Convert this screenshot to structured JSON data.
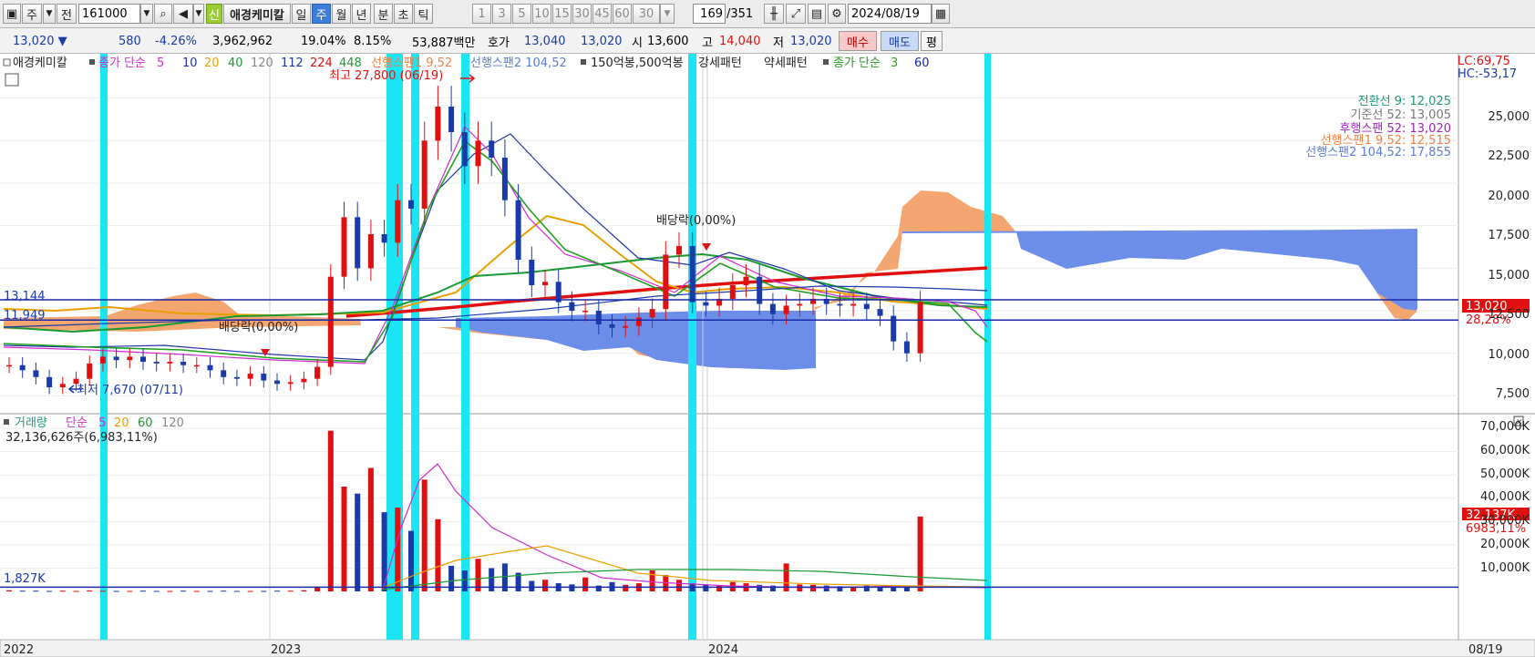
{
  "toolbar": {
    "period_labels": [
      "주",
      "전"
    ],
    "code": "161000",
    "new_badge": "신",
    "stock_name": "애경케미칼",
    "timeframes": [
      "일",
      "주",
      "월",
      "년",
      "분",
      "초",
      "틱"
    ],
    "selected_timeframe": "주",
    "intervals": [
      "1",
      "3",
      "5",
      "10",
      "15",
      "30",
      "45",
      "60"
    ],
    "interval_select": "30",
    "count": "169",
    "count_total": "/351",
    "date": "2024/08/19"
  },
  "quote": {
    "price": "13,020",
    "change": "580",
    "change_rate": "-4.26%",
    "volume": "3,962,962",
    "turnover_rate": "19.04%",
    "ratio2": "8.15%",
    "amount": "53,887백만",
    "bid_label": "호가",
    "bid1": "13,040",
    "bid2": "13,020",
    "open_label": "시",
    "open": "13,600",
    "high_label": "고",
    "high": "14,040",
    "low_label": "저",
    "low": "13,020",
    "buy_label": "매수",
    "sell_label": "매도",
    "avg_label": "평"
  },
  "legend": {
    "name": "애경케미칼",
    "ma_title": "종가 단순",
    "ma": [
      {
        "label": "5",
        "color": "#d02bd0"
      },
      {
        "label": "10",
        "color": "#2233aa"
      },
      {
        "label": "20",
        "color": "#e8a000"
      },
      {
        "label": "40",
        "color": "#1a9a33"
      },
      {
        "label": "120",
        "color": "#888888"
      },
      {
        "label": "112",
        "color": "#1a3aa8"
      },
      {
        "label": "224",
        "color": "#e01010"
      },
      {
        "label": "448",
        "color": "#1a9a33"
      }
    ],
    "span1": "선행스팬1 9,52",
    "span2": "선행스팬2 104,52",
    "pattern_a": "150억봉,500억봉",
    "pattern_b": "강세패턴",
    "pattern_c": "약세패턴",
    "ma2_title": "종가 단순",
    "ma2": [
      {
        "label": "3",
        "color": "#20a020"
      },
      {
        "label": "60",
        "color": "#1a2aa8"
      }
    ]
  },
  "price_panel": {
    "high_marker": "최고 27,800 (06/19)",
    "low_marker": "최저 7,670 (07/11)",
    "dividend1": "배당락(0,00%)",
    "dividend2": "배당락(0,00%)",
    "hline1_label": "13,144",
    "hline2_label": "11,949",
    "lc": "LC:69,75",
    "hc": "HC:-53,17",
    "current_price_label": "13,020",
    "current_rate_label": "28,28%",
    "ichimoku": [
      {
        "text": "전환선 9: 12,025",
        "color": "#1a9a7a"
      },
      {
        "text": "기준선 52: 13,005",
        "color": "#777777"
      },
      {
        "text": "후행스팬 52: 13,020",
        "color": "#a020c0"
      },
      {
        "text": "선행스팬1 9,52: 12,515",
        "color": "#f08040"
      },
      {
        "text": "선행스팬2 104,52: 17,855",
        "color": "#5a7ad8"
      }
    ],
    "y_ticks": [
      "25,000",
      "22,500",
      "20,000",
      "17,500",
      "15,000",
      "12,500",
      "10,000",
      "7,500"
    ]
  },
  "volume_panel": {
    "title": "거래량",
    "ma_title": "단순",
    "ma": [
      {
        "label": "5",
        "color": "#d02bd0"
      },
      {
        "label": "20",
        "color": "#e8a000"
      },
      {
        "label": "60",
        "color": "#1a9a33"
      },
      {
        "label": "120",
        "color": "#888888"
      }
    ],
    "latest_volume": "32,136,626주(6,983,11%)",
    "hline_label": "1,827K",
    "current_label": "32,137K",
    "current_rate": "6983,11%",
    "y_ticks": [
      "70,000K",
      "60,000K",
      "50,000K",
      "40,000K",
      "30,000K",
      "20,000K",
      "10,000K"
    ]
  },
  "x_axis": {
    "labels": [
      "2022",
      "2023",
      "2024"
    ],
    "right_label": "08/19"
  },
  "chart_data": {
    "type": "candlestick",
    "x_labels": [
      "2022",
      "2023",
      "2024"
    ],
    "ylim": [
      6500,
      27500
    ],
    "vol_ylim": [
      0,
      72000
    ],
    "weekly_close_approx": [
      9300,
      9000,
      8600,
      8000,
      8200,
      8500,
      9400,
      9800,
      9600,
      9800,
      9500,
      9400,
      9500,
      9300,
      9300,
      9000,
      8600,
      8500,
      8800,
      8400,
      8200,
      8300,
      8500,
      9200,
      14500,
      18000,
      15000,
      17000,
      16500,
      19000,
      18500,
      22500,
      24500,
      23000,
      21000,
      22500,
      21500,
      19000,
      15500,
      14000,
      14200,
      13000,
      12500,
      12500,
      11700,
      11500,
      11600,
      12100,
      12600,
      15800,
      16300,
      13000,
      12800,
      13200,
      14000,
      14500,
      12900,
      12300,
      12800,
      12900,
      13200,
      12900,
      12800,
      12900,
      12600,
      12200,
      10700,
      10000,
      13020
    ],
    "weekly_volume_approx": [
      500,
      300,
      300,
      200,
      300,
      200,
      400,
      300,
      200,
      200,
      300,
      200,
      200,
      300,
      200,
      200,
      300,
      200,
      200,
      200,
      300,
      300,
      500,
      2000,
      69000,
      45000,
      42000,
      53000,
      34000,
      36000,
      26000,
      48000,
      31000,
      11000,
      9000,
      14000,
      10000,
      12000,
      8000,
      4500,
      5000,
      3500,
      3000,
      6000,
      2500,
      4000,
      2800,
      3500,
      9000,
      7000,
      5000,
      3500,
      3000,
      2500,
      4000,
      3500,
      2800,
      2500,
      12000,
      3000,
      2800,
      2500,
      2200,
      2000,
      2500,
      2200,
      2000,
      2500,
      32137
    ],
    "current_price": 13020,
    "h_lines": [
      13144,
      11949
    ]
  }
}
